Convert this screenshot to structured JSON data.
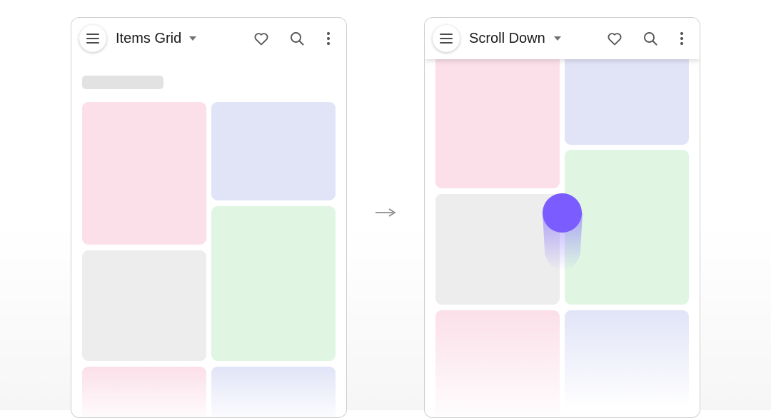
{
  "screens": [
    {
      "id": "items-grid",
      "title": "Items Grid",
      "actions": {
        "favorite_icon": "heart-icon",
        "search_icon": "search-icon",
        "more_icon": "more-vert-icon"
      },
      "menu_icon": "hamburger-icon"
    },
    {
      "id": "scroll-down",
      "title": "Scroll Down",
      "actions": {
        "favorite_icon": "heart-icon",
        "search_icon": "search-icon",
        "more_icon": "more-vert-icon"
      },
      "menu_icon": "hamburger-icon"
    }
  ],
  "transition_icon": "arrow-right-icon",
  "gesture": {
    "type": "swipe-up",
    "indicator": "touch-dot"
  },
  "colors": {
    "tile_pink": "#fbdfe9",
    "tile_lavender": "#e1e4f7",
    "tile_mint": "#e0f6e3",
    "tile_gray": "#ededed",
    "touch_accent": "#7a5cff",
    "skeleton": "#e2e2e2"
  }
}
